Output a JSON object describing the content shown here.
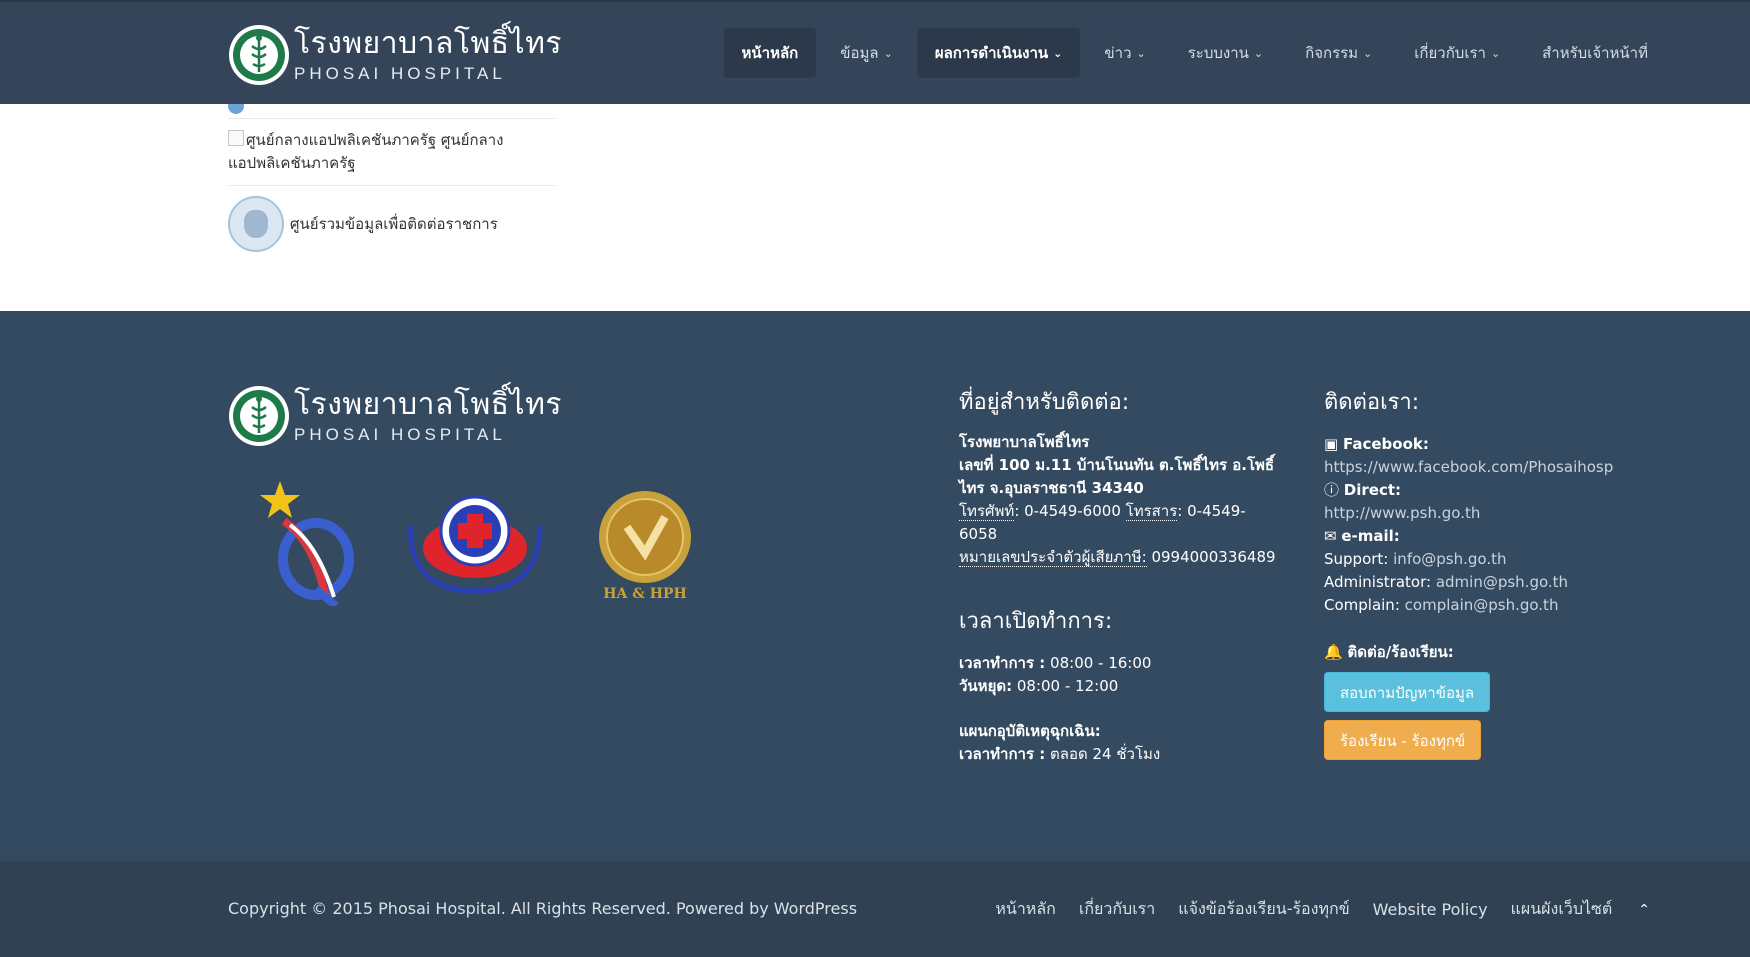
{
  "brand": {
    "name_th": "โรงพยาบาลโพธิ์ไทร",
    "name_en": "PHOSAI HOSPITAL"
  },
  "nav": {
    "items": [
      {
        "label": "หน้าหลัก",
        "has_dropdown": false,
        "active": true
      },
      {
        "label": "ข้อมูล",
        "has_dropdown": true,
        "active": false
      },
      {
        "label": "ผลการดำเนินงาน",
        "has_dropdown": true,
        "active": true
      },
      {
        "label": "ข่าว",
        "has_dropdown": true,
        "active": false
      },
      {
        "label": "ระบบงาน",
        "has_dropdown": true,
        "active": false
      },
      {
        "label": "กิจกรรม",
        "has_dropdown": true,
        "active": false
      },
      {
        "label": "เกี่ยวกับเรา",
        "has_dropdown": true,
        "active": false
      },
      {
        "label": "สำหรับเจ้าหน้าที่",
        "has_dropdown": false,
        "active": false
      }
    ]
  },
  "content": {
    "links": [
      {
        "label": "ศูนย์กลางแอปพลิเคชันภาครัฐ ศูนย์กลางแอปพลิเคชันภาครัฐ"
      },
      {
        "label": "ศูนย์รวมข้อมูลเพื่อติดต่อราชการ"
      }
    ]
  },
  "badges": {
    "ha_text": "HA & HPH"
  },
  "address": {
    "heading": "ที่อยู่สำหรับติดต่อ:",
    "org": "โรงพยาบาลโพธิ์ไทร",
    "line": "เลขที่ 100 ม.11 บ้านโนนทัน ต.โพธิ์ไทร อ.โพธิ์ไทร จ.อุบลราชธานี 34340",
    "phone_label": "โทรศัพท์",
    "phone": "0-4549-6000",
    "fax_label": "โทรสาร",
    "fax": "0-4549-6058",
    "tax_label": "หมายเลขประจำตัวผู้เสียภาษี:",
    "tax": "0994000336489"
  },
  "hours": {
    "heading": "เวลาเปิดทำการ:",
    "work_label": "เวลาทำการ :",
    "work": "08:00 - 16:00",
    "holiday_label": "วันหยุด:",
    "holiday": "08:00 - 12:00",
    "er_label": "แผนกอุบัติเหตุฉุกเฉิน:",
    "er_hours_label": "เวลาทำการ :",
    "er_hours": "ตลอด 24 ชั่วโมง"
  },
  "contact": {
    "heading": "ติดต่อเรา:",
    "facebook_label": "Facebook:",
    "facebook": "https://www.facebook.com/Phosaihosp",
    "direct_label": "Direct:",
    "direct": "http://www.psh.go.th",
    "email_label": "e-mail:",
    "support_label": "Support:",
    "support": "info@psh.go.th",
    "admin_label": "Administrator:",
    "admin": "admin@psh.go.th",
    "complain_label": "Complain:",
    "complain": "complain@psh.go.th",
    "complaint_heading": "ติดต่อ/ร้องเรียน:",
    "btn_inquiry": "สอบถามปัญหาข้อมูล",
    "btn_complaint": "ร้องเรียน - ร้องทุกข์"
  },
  "footer": {
    "copyright": "Copyright © 2015 Phosai Hospital. All Rights Reserved. Powered by WordPress",
    "links": [
      {
        "label": "หน้าหลัก"
      },
      {
        "label": "เกี่ยวกับเรา"
      },
      {
        "label": "แจ้งข้อร้องเรียน-ร้องทุกข์"
      },
      {
        "label": "Website Policy"
      },
      {
        "label": "แผนผังเว็บไซต์"
      }
    ]
  },
  "colors": {
    "navbar": "#344559",
    "footer": "#344a60",
    "footer_bottom": "#2f4153",
    "btn_info": "#5bc0de",
    "btn_warning": "#f0ad4e"
  }
}
